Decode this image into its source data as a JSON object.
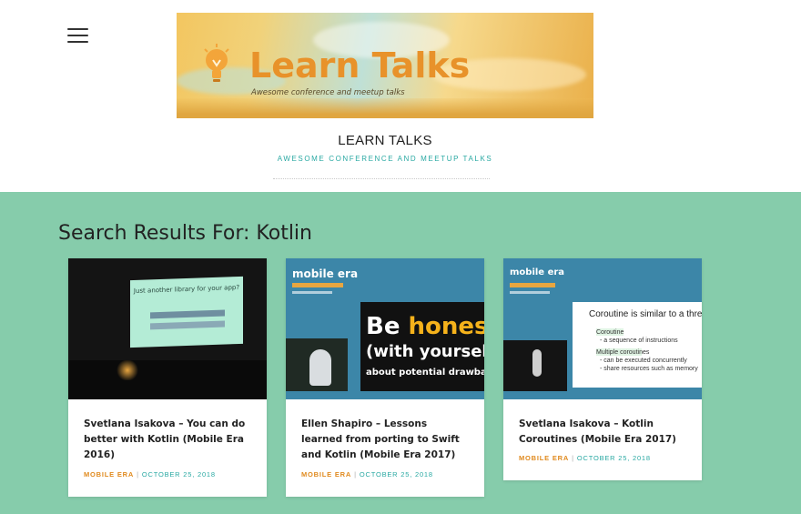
{
  "header": {
    "menu_label": "Menu",
    "banner": {
      "title": "Learn Talks",
      "tagline": "Awesome conference and meetup talks"
    },
    "site_title": "LEARN TALKS",
    "site_tagline": "AWESOME CONFERENCE AND MEETUP TALKS"
  },
  "search": {
    "heading": "Search Results For: Kotlin"
  },
  "posts": [
    {
      "title": "Svetlana Isakova – You can do better with Kotlin (Mobile Era 2016)",
      "category": "MOBILE ERA",
      "date": "OCTOBER 25, 2018",
      "thumb": {
        "slide_text": "Just another library for your app?"
      }
    },
    {
      "title": "Ellen Shapiro – Lessons learned from porting to Swift and Kotlin (Mobile Era 2017)",
      "category": "MOBILE ERA",
      "date": "OCTOBER 25, 2018",
      "thumb": {
        "brand": "mobile era",
        "slide_line1_a": "Be ",
        "slide_line1_b": "hones",
        "slide_line2": "(with yoursel",
        "slide_line3": "about potential drawbac"
      }
    },
    {
      "title": "Svetlana Isakova – Kotlin Coroutines (Mobile Era 2017)",
      "category": "MOBILE ERA",
      "date": "OCTOBER 25, 2018",
      "thumb": {
        "brand": "mobile era",
        "slide_heading": "Coroutine is similar to a thre",
        "bullets": [
          "Coroutine",
          "- a sequence of instructions",
          "Multiple coroutines",
          "- can be executed concurrently",
          "- share resources such as memory"
        ]
      }
    }
  ],
  "colors": {
    "main_bg": "#86ccab",
    "accent_teal": "#2aa9a3",
    "category_orange": "#e08a1e"
  }
}
